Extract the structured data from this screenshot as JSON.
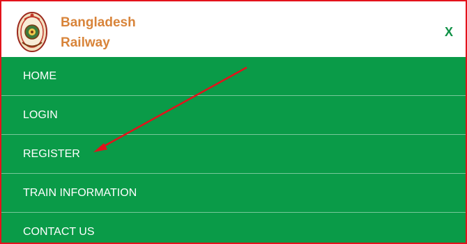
{
  "header": {
    "brand_line1": "Bangladesh",
    "brand_line2": "Railway",
    "logo_icon": "bangladesh-railway-emblem-icon",
    "close_label": "X"
  },
  "menu": {
    "items": [
      {
        "label": "HOME"
      },
      {
        "label": "LOGIN"
      },
      {
        "label": "REGISTER"
      },
      {
        "label": "TRAIN INFORMATION"
      },
      {
        "label": "CONTACT US"
      }
    ]
  },
  "annotation": {
    "arrow_icon": "red-pointer-arrow-icon",
    "points_to": "REGISTER"
  },
  "colors": {
    "brand_text": "#d8843a",
    "menu_bg": "#0a9b48",
    "close_icon": "#0f9146",
    "frame_border": "#e3121b",
    "arrow": "#e3121b"
  }
}
